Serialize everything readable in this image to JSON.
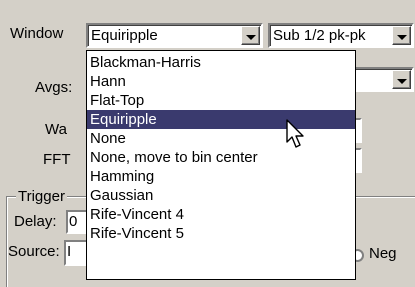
{
  "window_row": {
    "label": "Window",
    "selected": "Equiripple",
    "secondary_selected": "Sub 1/2 pk-pk"
  },
  "labels": {
    "avgs": "Avgs:",
    "wa": "Wa",
    "fft": "FFT",
    "trigger": "Trigger",
    "delay": "Delay:",
    "delay_value": "0",
    "source": "Source:",
    "source_value": "I",
    "neg": "Neg"
  },
  "window_options": [
    "Blackman-Harris",
    "Hann",
    "Flat-Top",
    "Equiripple",
    "None",
    "None, move to bin center",
    "Hamming",
    "Gaussian",
    "Rife-Vincent 4",
    "Rife-Vincent 5"
  ],
  "selected_option_index": 3,
  "colors": {
    "selection_bg": "#3a3a6e",
    "face": "#d4d0c8"
  }
}
